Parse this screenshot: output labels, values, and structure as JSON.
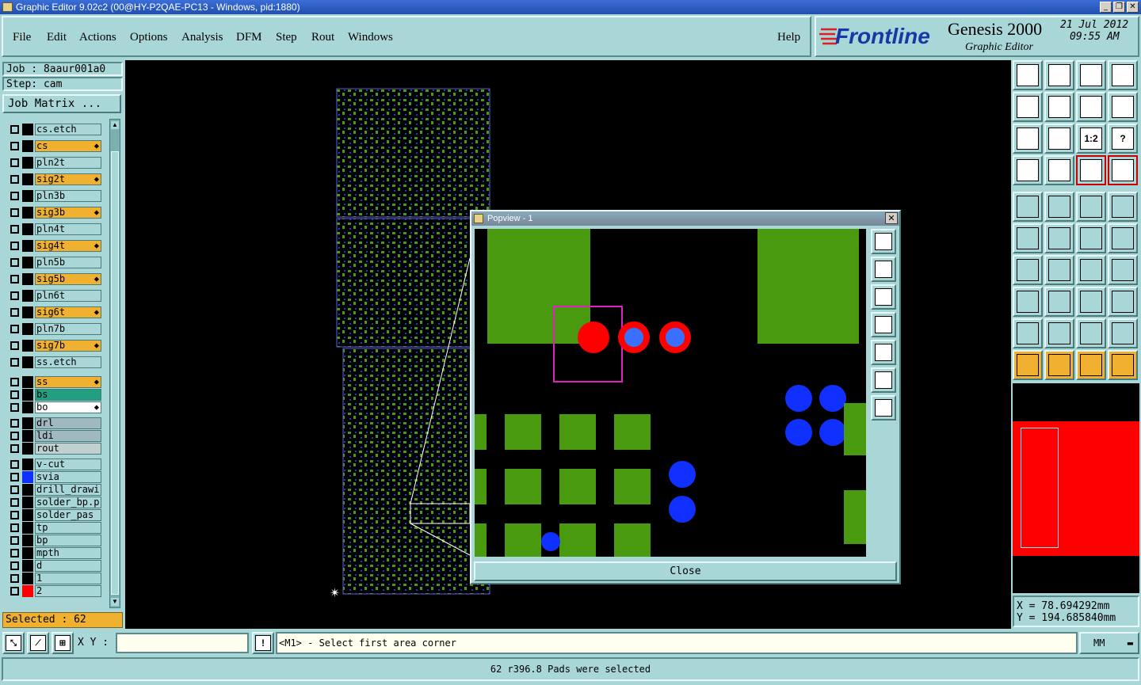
{
  "window": {
    "title": "Graphic Editor 9.02c2 (00@HY-P2QAE-PC13 - Windows, pid:1880)"
  },
  "menu": {
    "items": [
      {
        "label": "File"
      },
      {
        "label": "Edit"
      },
      {
        "label": "Actions"
      },
      {
        "label": "Options"
      },
      {
        "label": "Analysis"
      },
      {
        "label": "DFM"
      },
      {
        "label": "Step"
      },
      {
        "label": "Rout"
      },
      {
        "label": "Windows"
      }
    ],
    "help": "Help"
  },
  "brand": {
    "logo": "Frontline",
    "product": "Genesis 2000",
    "subtitle": "Graphic Editor",
    "date": "21 Jul 2012",
    "time": "09:55 AM"
  },
  "job": {
    "job_label": "Job : 8aaur001a0",
    "step_label": "Step: cam",
    "matrix_button": "Job Matrix ..."
  },
  "layers": [
    {
      "name": "cs.etch",
      "color": "#a9d6d6",
      "swatch": "#000000"
    },
    {
      "name": "cs",
      "color": "#f0b030",
      "swatch": "#000000",
      "mark": true
    },
    {
      "name": "pln2t",
      "color": "#a9d6d6",
      "swatch": "#000000"
    },
    {
      "name": "sig2t",
      "color": "#f0b030",
      "swatch": "#000000",
      "mark": true
    },
    {
      "name": "pln3b",
      "color": "#a9d6d6",
      "swatch": "#000000"
    },
    {
      "name": "sig3b",
      "color": "#f0b030",
      "swatch": "#000000",
      "mark": true
    },
    {
      "name": "pln4t",
      "color": "#a9d6d6",
      "swatch": "#000000"
    },
    {
      "name": "sig4t",
      "color": "#f0b030",
      "swatch": "#000000",
      "mark": true
    },
    {
      "name": "pln5b",
      "color": "#a9d6d6",
      "swatch": "#000000"
    },
    {
      "name": "sig5b",
      "color": "#f0b030",
      "swatch": "#000000",
      "mark": true
    },
    {
      "name": "pln6t",
      "color": "#a9d6d6",
      "swatch": "#000000"
    },
    {
      "name": "sig6t",
      "color": "#f0b030",
      "swatch": "#000000",
      "mark": true
    },
    {
      "name": "pln7b",
      "color": "#a9d6d6",
      "swatch": "#000000"
    },
    {
      "name": "sig7b",
      "color": "#f0b030",
      "swatch": "#000000",
      "mark": true
    },
    {
      "name": "ss.etch",
      "color": "#a9d6d6",
      "swatch": "#000000"
    },
    {
      "name": "ss",
      "color": "#f0b030",
      "swatch": "#000000",
      "mark": true
    },
    {
      "name": "bs",
      "color": "#20a080",
      "swatch": "#000000"
    },
    {
      "name": "bo",
      "color": "#ffffff",
      "swatch": "#000000",
      "mark": true
    },
    {
      "name": "drl",
      "color": "#a0b8c0",
      "swatch": "#000000"
    },
    {
      "name": "ldi",
      "color": "#a0b8c0",
      "swatch": "#000000"
    },
    {
      "name": "rout",
      "color": "#c0d0d0",
      "swatch": "#000000"
    },
    {
      "name": "v-cut",
      "color": "#a9d6d6",
      "swatch": "#000000"
    },
    {
      "name": "svia",
      "color": "#a9d6d6",
      "swatch": "#1030ff"
    },
    {
      "name": "drill_drawi",
      "color": "#a9d6d6",
      "swatch": "#000000"
    },
    {
      "name": "solder_bp.p",
      "color": "#a9d6d6",
      "swatch": "#000000"
    },
    {
      "name": "solder_pas",
      "color": "#a9d6d6",
      "swatch": "#000000"
    },
    {
      "name": "tp",
      "color": "#a9d6d6",
      "swatch": "#000000"
    },
    {
      "name": "bp",
      "color": "#a9d6d6",
      "swatch": "#000000"
    },
    {
      "name": "mpth",
      "color": "#a9d6d6",
      "swatch": "#000000"
    },
    {
      "name": "d",
      "color": "#a9d6d6",
      "swatch": "#000000"
    },
    {
      "name": "1",
      "color": "#a9d6d6",
      "swatch": "#000000"
    },
    {
      "name": "2",
      "color": "#a9d6d6",
      "swatch": "#ff0000"
    }
  ],
  "selected": "Selected : 62",
  "popview": {
    "title": "Popview - 1",
    "close_label": "Close"
  },
  "tools": {
    "row_labels": [
      "1:2",
      "?"
    ]
  },
  "coords": {
    "x": "X  = 78.694292mm",
    "y": "Y  = 194.685840mm"
  },
  "status": {
    "xy_label": "X Y :",
    "xy_value": "",
    "prompt": "<M1> - Select first area corner",
    "units": "MM"
  },
  "message": "62 r396.8 Pads were selected"
}
